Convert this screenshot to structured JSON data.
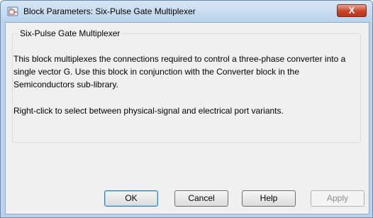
{
  "window": {
    "title": "Block Parameters: Six-Pulse Gate Multiplexer",
    "close_label": "X"
  },
  "group": {
    "title": "Six-Pulse Gate Multiplexer",
    "description_1": "This block multiplexes the connections required to control a three-phase converter into a single vector G. Use this block in conjunction with the Converter block in the Semiconductors sub-library.",
    "description_2": "Right-click to select between physical-signal and electrical port variants."
  },
  "buttons": {
    "ok": "OK",
    "cancel": "Cancel",
    "help": "Help",
    "apply": "Apply"
  },
  "icons": {
    "title_icon": "simulink-block-icon",
    "close_icon": "close-icon"
  }
}
